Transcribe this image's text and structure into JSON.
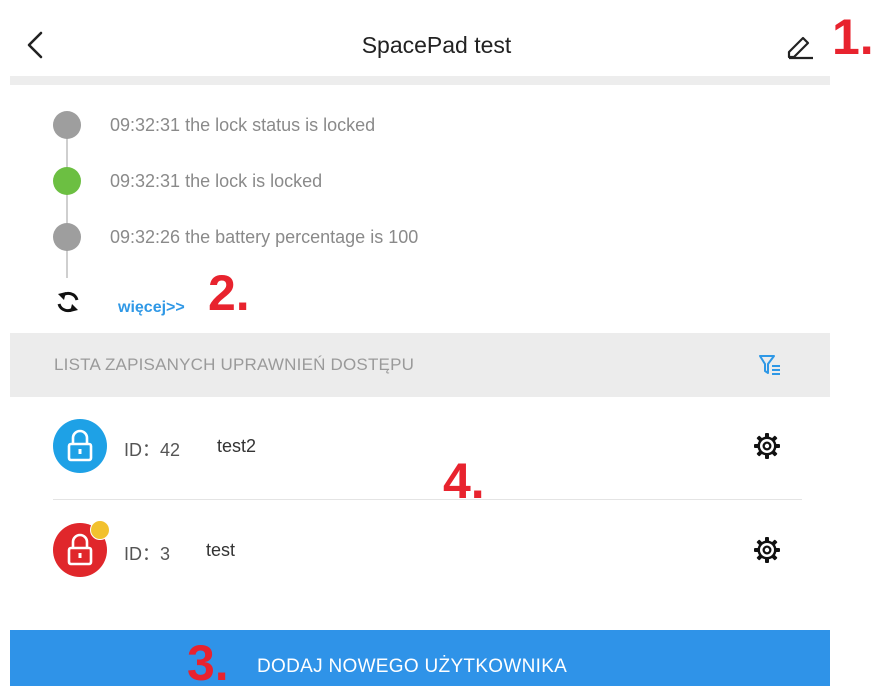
{
  "header": {
    "title": "SpacePad test",
    "back_icon": "chevron-left-icon",
    "edit_icon": "pencil-icon"
  },
  "annotations": {
    "a1": "1.",
    "a2": "2.",
    "a3": "3.",
    "a4": "4."
  },
  "timeline": {
    "events": [
      {
        "text": "09:32:31 the lock status is locked",
        "dot_color": "#9e9e9e"
      },
      {
        "text": "09:32:31 the lock is locked",
        "dot_color": "#6cbf42"
      },
      {
        "text": "09:32:26 the battery percentage is 100",
        "dot_color": "#9e9e9e"
      }
    ],
    "refresh_icon": "refresh-icon",
    "more_label": "więcej>>"
  },
  "access_list": {
    "title": "LISTA ZAPISANYCH UPRAWNIEŃ DOSTĘPU",
    "filter_icon": "filter-icon",
    "users": [
      {
        "id_label": "ID：42",
        "name": "test2",
        "avatar_color": "#1ea1e6",
        "icon": "lock-icon"
      },
      {
        "id_label": "ID：3",
        "name": "test",
        "avatar_color": "#e0272b",
        "icon": "lock-icon"
      }
    ]
  },
  "add_button": {
    "label": "DODAJ NOWEGO UŻYTKOWNIKA"
  },
  "colors": {
    "accent": "#2f93e8",
    "annotation": "#e8232e",
    "link": "#2f98e6"
  }
}
